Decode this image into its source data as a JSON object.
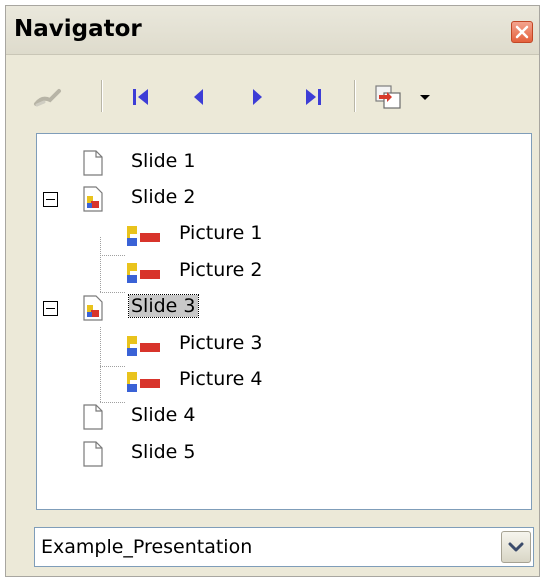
{
  "window": {
    "title": "Navigator"
  },
  "toolbar": {
    "buttons": [
      {
        "icon": "pointer-icon",
        "label": "Pointer"
      },
      {
        "icon": "first-slide-icon",
        "label": "First Slide"
      },
      {
        "icon": "previous-slide-icon",
        "label": "Previous Slide"
      },
      {
        "icon": "next-slide-icon",
        "label": "Next Slide"
      },
      {
        "icon": "last-slide-icon",
        "label": "Last Slide"
      },
      {
        "icon": "drag-mode-icon",
        "label": "Drag Mode"
      },
      {
        "icon": "chevron-down-icon",
        "label": "Drag Mode Menu"
      }
    ],
    "accent": "#3d3dd6"
  },
  "tree": {
    "items": [
      {
        "label": "Slide 1",
        "type": "slide",
        "expandable": false
      },
      {
        "label": "Slide 2",
        "type": "slide",
        "expandable": true,
        "expanded": true,
        "children": [
          {
            "label": "Picture 1"
          },
          {
            "label": "Picture 2"
          }
        ]
      },
      {
        "label": "Slide 3",
        "type": "slide",
        "expandable": true,
        "expanded": true,
        "selected": true,
        "children": [
          {
            "label": "Picture 3"
          },
          {
            "label": "Picture 4"
          }
        ]
      },
      {
        "label": "Slide 4",
        "type": "slide",
        "expandable": false
      },
      {
        "label": "Slide 5",
        "type": "slide",
        "expandable": false
      }
    ]
  },
  "document_selector": {
    "value": "Example_Presentation"
  }
}
